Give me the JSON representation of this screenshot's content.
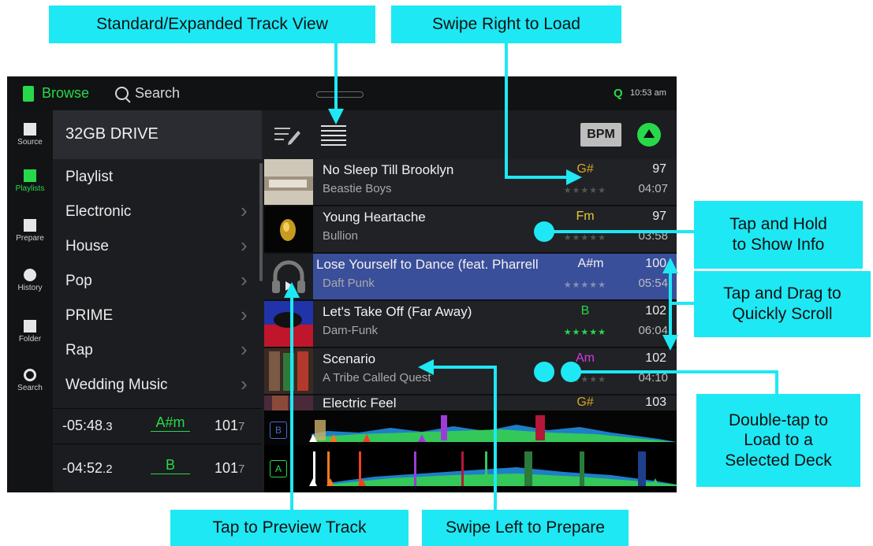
{
  "callouts": {
    "standard_expanded": "Standard/Expanded Track View",
    "swipe_right": "Swipe Right to Load",
    "tap_hold_1": "Tap and Hold",
    "tap_hold_2": "to Show Info",
    "tap_drag_1": "Tap and Drag to",
    "tap_drag_2": "Quickly Scroll",
    "double_tap_1": "Double-tap to",
    "double_tap_2": "Load to a",
    "double_tap_3": "Selected Deck",
    "preview": "Tap to Preview Track",
    "swipe_left": "Swipe Left to Prepare"
  },
  "topbar": {
    "browse": "Browse",
    "search": "Search",
    "q": "Q",
    "time": "10:53 am"
  },
  "rail": {
    "source": "Source",
    "playlists": "Playlists",
    "prepare": "Prepare",
    "history": "History",
    "folder": "Folder",
    "search": "Search"
  },
  "crate": {
    "title": "32GB DRIVE",
    "items": [
      "Playlist",
      "Electronic",
      "House",
      "Pop",
      "PRIME",
      "Rap",
      "Wedding Music"
    ]
  },
  "toolbar": {
    "bpm": "BPM"
  },
  "tracks": [
    {
      "title": "No Sleep Till Brooklyn",
      "artist": "Beastie Boys",
      "key": "G#",
      "bpm": "97",
      "time": "04:07",
      "stars": "★★★★★"
    },
    {
      "title": "Young Heartache",
      "artist": "Bullion",
      "key": "Fm",
      "bpm": "97",
      "time": "03:58",
      "stars": "★★★★★"
    },
    {
      "title": "Lose Yourself to Dance (feat. Pharrell",
      "artist": "Daft Punk",
      "key": "A#m",
      "bpm": "100",
      "time": "05:54",
      "stars": "★★★★★"
    },
    {
      "title": "Let's Take Off (Far Away)",
      "artist": "Dam-Funk",
      "key": "B",
      "bpm": "102",
      "time": "06:04",
      "stars": "★★★★★"
    },
    {
      "title": "Scenario",
      "artist": "A Tribe Called Quest",
      "key": "Am",
      "bpm": "102",
      "time": "04:10",
      "stars": "★★★★★"
    },
    {
      "title": "Electric Feel",
      "artist": "",
      "key": "G#",
      "bpm": "103",
      "time": "",
      "stars": ""
    }
  ],
  "decks": [
    {
      "time": "-05:48",
      "time_frac": ".3",
      "key": "A#m",
      "bpm": "101",
      "bpm_frac": "7",
      "label": "B"
    },
    {
      "time": "-04:52",
      "time_frac": ".2",
      "key": "B",
      "bpm": "101",
      "bpm_frac": "7",
      "label": "A"
    }
  ],
  "colors": {
    "accent": "#27d94a",
    "callout": "#1ee8f4",
    "selected_row": "#3a4f9a",
    "key_g_sharp": "#d9a521",
    "key_fm": "#e7c93a",
    "key_am": "#d53adf",
    "key_b": "#27d94a"
  }
}
